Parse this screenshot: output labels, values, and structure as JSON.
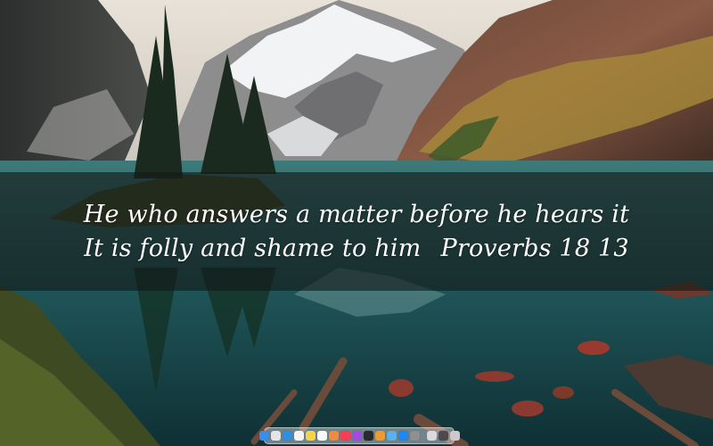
{
  "quote": {
    "line1": "He who answers a matter before he hears it",
    "line2": "It is folly and shame to him",
    "reference": "Proverbs 18 13"
  },
  "dock": {
    "apps": [
      {
        "icon": "finder-icon",
        "color": "#3a8de8"
      },
      {
        "icon": "launchpad-icon",
        "color": "#e4e4e8"
      },
      {
        "icon": "safari-icon",
        "color": "#2f8fe0"
      },
      {
        "icon": "calendar-icon",
        "color": "#f4f4f4"
      },
      {
        "icon": "notes-icon",
        "color": "#f5d44b"
      },
      {
        "icon": "reminders-icon",
        "color": "#fafafa"
      },
      {
        "icon": "photos-icon",
        "color": "#f08a3c"
      },
      {
        "icon": "music-icon",
        "color": "#fb3c52"
      },
      {
        "icon": "podcasts-icon",
        "color": "#a44be0"
      },
      {
        "icon": "terminal-icon",
        "color": "#2a2a2a"
      },
      {
        "icon": "books-icon",
        "color": "#f29a2b"
      },
      {
        "icon": "preview-icon",
        "color": "#5fb0e8"
      },
      {
        "icon": "app-store-icon",
        "color": "#1e88f0"
      },
      {
        "icon": "settings-icon",
        "color": "#8e8e93"
      }
    ],
    "extras": [
      {
        "icon": "folder-icon",
        "color": "#d9d9de"
      },
      {
        "icon": "screenshot-icon",
        "color": "#4b4b4f"
      },
      {
        "icon": "trash-icon",
        "color": "#c9c9ce"
      }
    ]
  }
}
